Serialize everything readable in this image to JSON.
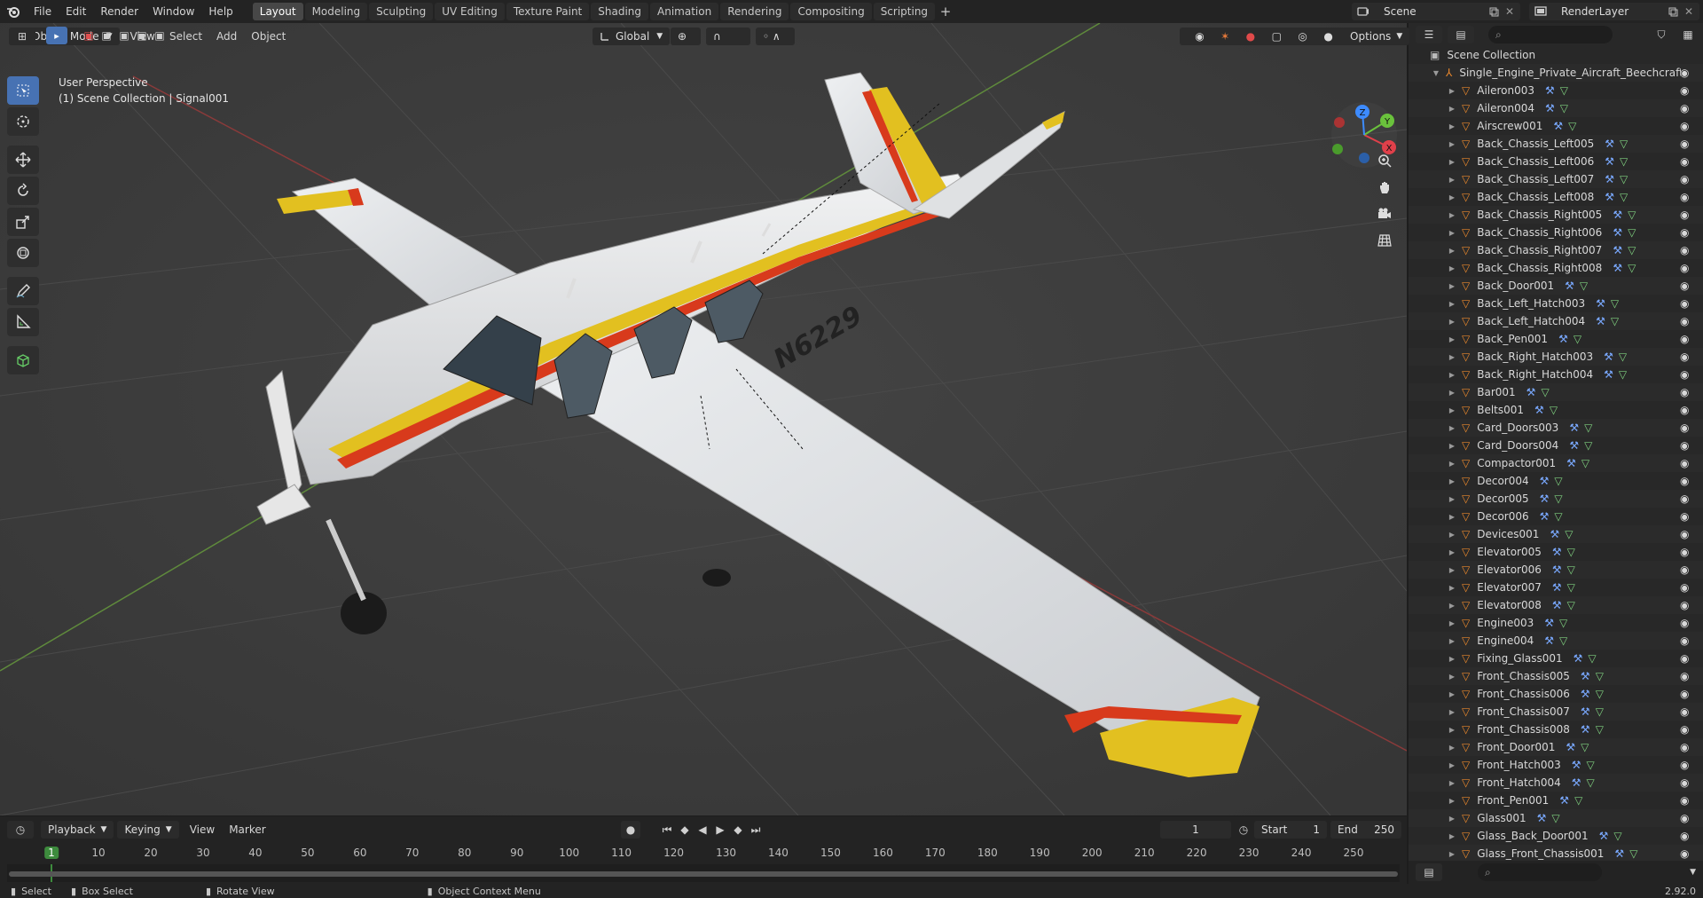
{
  "topbar": {
    "menu": [
      "File",
      "Edit",
      "Render",
      "Window",
      "Help"
    ],
    "workspaces": [
      "Layout",
      "Modeling",
      "Sculpting",
      "UV Editing",
      "Texture Paint",
      "Shading",
      "Animation",
      "Rendering",
      "Compositing",
      "Scripting"
    ],
    "active_workspace": "Layout",
    "add_symbol": "+",
    "scene": "Scene",
    "render_layer": "RenderLayer"
  },
  "viewport": {
    "mode": "Object Mode",
    "menus": [
      "View",
      "Select",
      "Add",
      "Object"
    ],
    "orientation": "Global",
    "options": "Options",
    "overlay_line1": "User Perspective",
    "overlay_line2": "(1) Scene Collection | Signal001",
    "aircraft_registration": "N6229",
    "gizmo": {
      "x": "X",
      "y": "Y",
      "z": "Z"
    }
  },
  "timeline": {
    "menus": [
      "Playback",
      "Keying",
      "View",
      "Marker"
    ],
    "current_frame": "1",
    "start_label": "Start",
    "start": "1",
    "end_label": "End",
    "end": "250",
    "ticks": [
      "1",
      "10",
      "20",
      "30",
      "40",
      "50",
      "60",
      "70",
      "80",
      "90",
      "100",
      "110",
      "120",
      "130",
      "140",
      "150",
      "160",
      "170",
      "180",
      "190",
      "200",
      "210",
      "220",
      "230",
      "240",
      "250"
    ]
  },
  "statusbar": {
    "select": "Select",
    "box_select": "Box Select",
    "rotate_view": "Rotate View",
    "context_menu": "Object Context Menu",
    "version": "2.92.0"
  },
  "outliner": {
    "root": "Scene Collection",
    "collection": "Single_Engine_Private_Aircraft_Beechcraft_E",
    "items": [
      "Aileron003",
      "Aileron004",
      "Airscrew001",
      "Back_Chassis_Left005",
      "Back_Chassis_Left006",
      "Back_Chassis_Left007",
      "Back_Chassis_Left008",
      "Back_Chassis_Right005",
      "Back_Chassis_Right006",
      "Back_Chassis_Right007",
      "Back_Chassis_Right008",
      "Back_Door001",
      "Back_Left_Hatch003",
      "Back_Left_Hatch004",
      "Back_Pen001",
      "Back_Right_Hatch003",
      "Back_Right_Hatch004",
      "Bar001",
      "Belts001",
      "Card_Doors003",
      "Card_Doors004",
      "Compactor001",
      "Decor004",
      "Decor005",
      "Decor006",
      "Devices001",
      "Elevator005",
      "Elevator006",
      "Elevator007",
      "Elevator008",
      "Engine003",
      "Engine004",
      "Fixing_Glass001",
      "Front_Chassis005",
      "Front_Chassis006",
      "Front_Chassis007",
      "Front_Chassis008",
      "Front_Door001",
      "Front_Hatch003",
      "Front_Hatch004",
      "Front_Pen001",
      "Glass001",
      "Glass_Back_Door001",
      "Glass_Front_Chassis001"
    ]
  },
  "colors": {
    "accent": "#4772b3",
    "object_orange": "#e8872c",
    "modifier_blue": "#7aa9ff",
    "mesh_green": "#7fd07f",
    "axis_x": "#e0404a",
    "axis_y": "#6ac23c",
    "axis_z": "#3d8bff"
  }
}
